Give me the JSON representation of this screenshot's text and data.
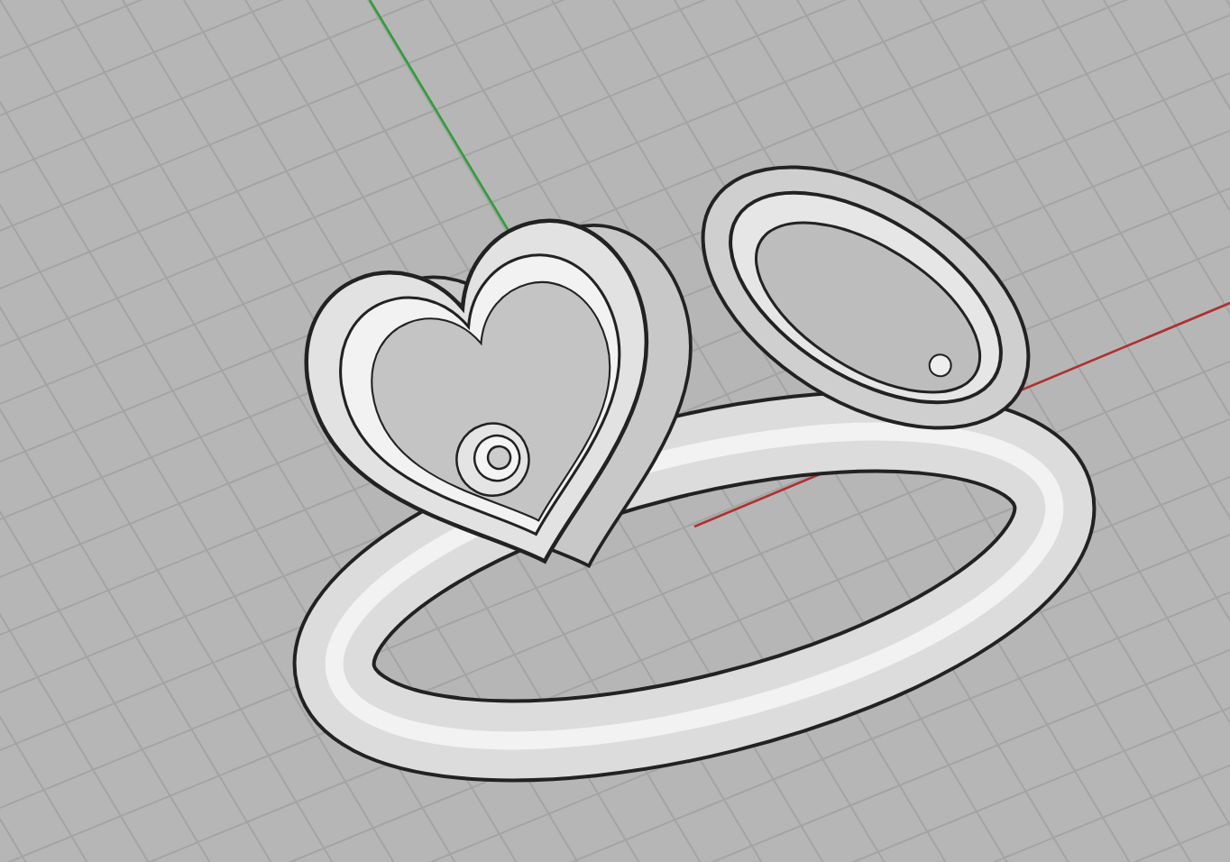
{
  "viewport": {
    "kind": "perspective",
    "grid": true,
    "axes": true
  }
}
